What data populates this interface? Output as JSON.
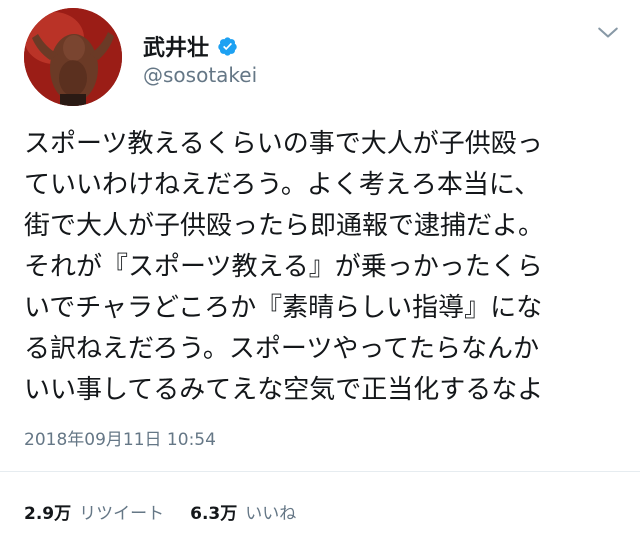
{
  "tweet": {
    "author": {
      "display_name": "武井壮",
      "handle": "@sosotakei",
      "verified": true
    },
    "body_lines": [
      "スポーツ教えるくらいの事で大人が子供殴っ",
      "ていいわけねえだろう。よく考えろ本当に、",
      "街で大人が子供殴ったら即通報で逮捕だよ。",
      "それが『スポーツ教える』が乗っかったくら",
      "いでチャラどころか『素晴らしい指導』にな",
      "る訳ねえだろう。スポーツやってたらなんか",
      "いい事してるみてえな空気で正当化するなよ"
    ],
    "timestamp": "2018年09月11日 10:54",
    "stats": {
      "retweets_count": "2.9万",
      "retweets_label": "リツイート",
      "likes_count": "6.3万",
      "likes_label": "いいね"
    }
  },
  "icons": {
    "verified": "verified-badge-icon",
    "menu": "chevron-down-icon"
  },
  "colors": {
    "text_primary": "#14171a",
    "text_secondary": "#657786",
    "verified_blue": "#1da1f2",
    "divider": "#e6ecf0"
  }
}
